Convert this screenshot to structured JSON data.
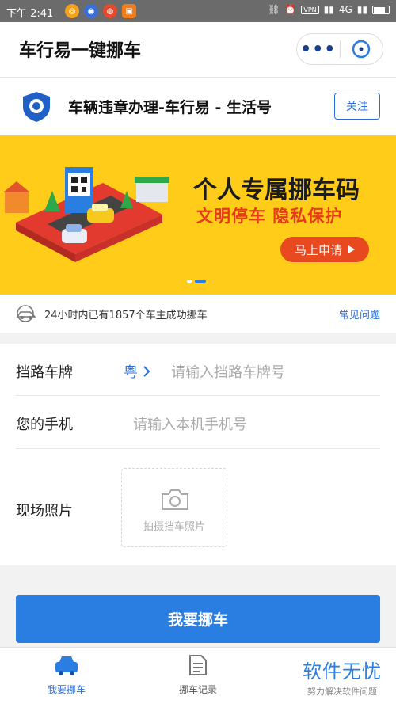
{
  "status_bar": {
    "time": "下午 2:41",
    "network": "4G",
    "vpn": "VPN"
  },
  "header": {
    "title": "车行易一键挪车"
  },
  "account": {
    "name": "车辆违章办理-车行易 - 生活号",
    "follow_label": "关注"
  },
  "banner": {
    "headline": "个人专属挪车码",
    "subline": "文明停车  隐私保护",
    "apply_label": "马上申请",
    "slide_count": 2,
    "active_slide": 2
  },
  "info": {
    "stat_text": "24小时内已有1857个车主成功挪车",
    "faq_label": "常见问题"
  },
  "form": {
    "plate_label": "挡路车牌",
    "province": "粤",
    "plate_placeholder": "请输入挡路车牌号",
    "phone_label": "您的手机",
    "phone_placeholder": "请输入本机手机号",
    "photo_label": "现场照片",
    "photo_hint": "拍摄挡车照片"
  },
  "submit_label": "我要挪车",
  "tabs": [
    {
      "label": "我要挪车",
      "icon": "car-icon",
      "active": true
    },
    {
      "label": "挪车记录",
      "icon": "document-icon",
      "active": false
    }
  ],
  "watermark": {
    "title": "软件无忧",
    "subtitle": "努力解决软件问题"
  },
  "colors": {
    "primary": "#2a7de1",
    "banner_bg": "#ffcc1a",
    "accent_red": "#e8491f"
  }
}
